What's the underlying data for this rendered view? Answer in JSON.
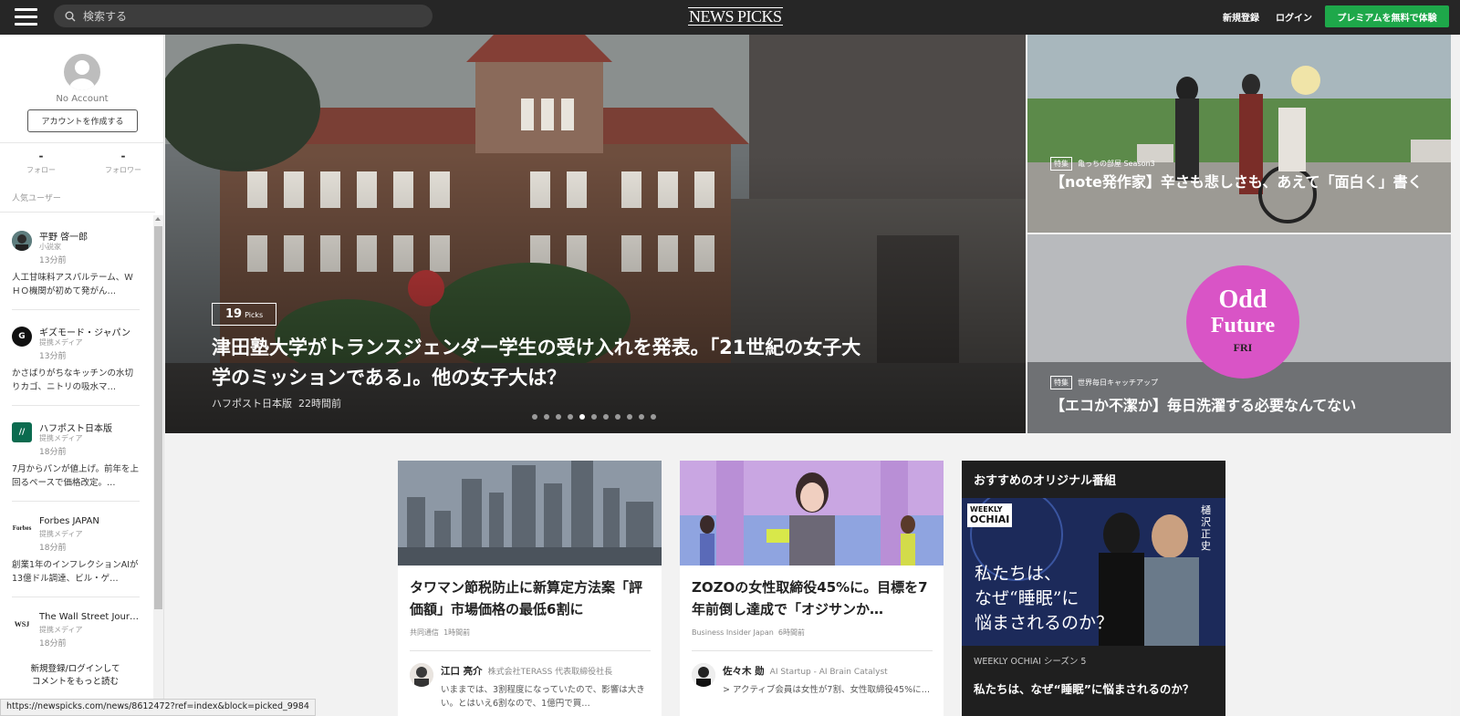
{
  "header": {
    "search_placeholder": "検索する",
    "logo": "NEWS PICKS",
    "signup": "新規登録",
    "login": "ログイン",
    "premium": "プレミアムを無料で体験"
  },
  "sidebar": {
    "account_name": "No Account",
    "create_account": "アカウントを作成する",
    "follow_count": "-",
    "follow_label": "フォロー",
    "follower_count": "-",
    "follower_label": "フォロワー",
    "popular_users_title": "人気ユーザー",
    "feed": [
      {
        "name": "平野 啓一郎",
        "role": "小説家",
        "time": "13分前",
        "text": "人工甘味料アスパルテーム、ＷＨＯ機関が初めて発がん…"
      },
      {
        "name": "ギズモード・ジャパン",
        "role": "提携メディア",
        "time": "13分前",
        "text": "かさばりがちなキッチンの水切りカゴ、ニトリの吸水マ…"
      },
      {
        "name": "ハフポスト日本版",
        "role": "提携メディア",
        "time": "18分前",
        "text": "7月からパンが値上げ。前年を上回るペースで価格改定。…"
      },
      {
        "name": "Forbes JAPAN",
        "role": "提携メディア",
        "time": "18分前",
        "text": "創業1年のインフレクションAIが13億ドル調達、ビル・ゲ…"
      },
      {
        "name": "The Wall Street Jour…",
        "role": "提携メディア",
        "time": "18分前",
        "text": ""
      }
    ],
    "cta": "新規登録/ログインして\nコメントをもっと読む"
  },
  "hero": {
    "picks_count": "19",
    "picks_label": "Picks",
    "title": "津田塾大学がトランスジェンダー学生の受け入れを発表。「21世紀の女子大学のミッションである」。他の女子大は？",
    "source": "ハフポスト日本版",
    "time": "22時間前",
    "slide_count": 11,
    "active_slide": 4
  },
  "side_cards": [
    {
      "tag": "特集",
      "series": "亀っちの部屋 Season3",
      "title": "【note発作家】辛さも悲しさも、あえて「面白く」書く"
    },
    {
      "tag": "特集",
      "series": "世界毎日キャッチアップ",
      "title": "【エコか不潔か】毎日洗濯する必要なんてない",
      "logo_line1": "Odd",
      "logo_line2": "Future",
      "logo_day": "FRI"
    }
  ],
  "cards": [
    {
      "title": "タワマン節税防止に新算定方法案「評価額」市場価格の最低6割に",
      "source": "共同通信",
      "time": "1時間前",
      "user": "江口 亮介",
      "user_role": "株式会社TERASS 代表取締役社長",
      "comment": "いままでは、3割程度になっていたので、影響は大きい。とはいえ6割なので、1億円で買…"
    },
    {
      "title": "ZOZOの女性取締役45%に。目標を7年前倒し達成で「オジサンか…",
      "source": "Business Insider Japan",
      "time": "6時間前",
      "user": "佐々木 勋",
      "user_role": "AI Startup - AI Brain Catalyst",
      "comment": "> アクティブ会員は女性が7割、女性取締役45%に…"
    }
  ],
  "recommend": {
    "heading": "おすすめのオリジナル番組",
    "badge_line1": "WEEKLY",
    "badge_line2": "OCHIAI",
    "guest": "樋沢正史",
    "thumb_text_1": "私たちは、",
    "thumb_text_2": "なぜ“睡眠”に",
    "thumb_text_3": "悩まされるのか？",
    "series": "WEEKLY OCHIAI シーズン 5",
    "title": "私たちは、なぜ“睡眠”に悩まされるのか？"
  },
  "status_url": "https://newspicks.com/news/8612472?ref=index&block=picked_9984",
  "colors": {
    "header_bg": "#262626",
    "premium_green": "#1ea84a",
    "page_bg": "#f2f2f2"
  }
}
